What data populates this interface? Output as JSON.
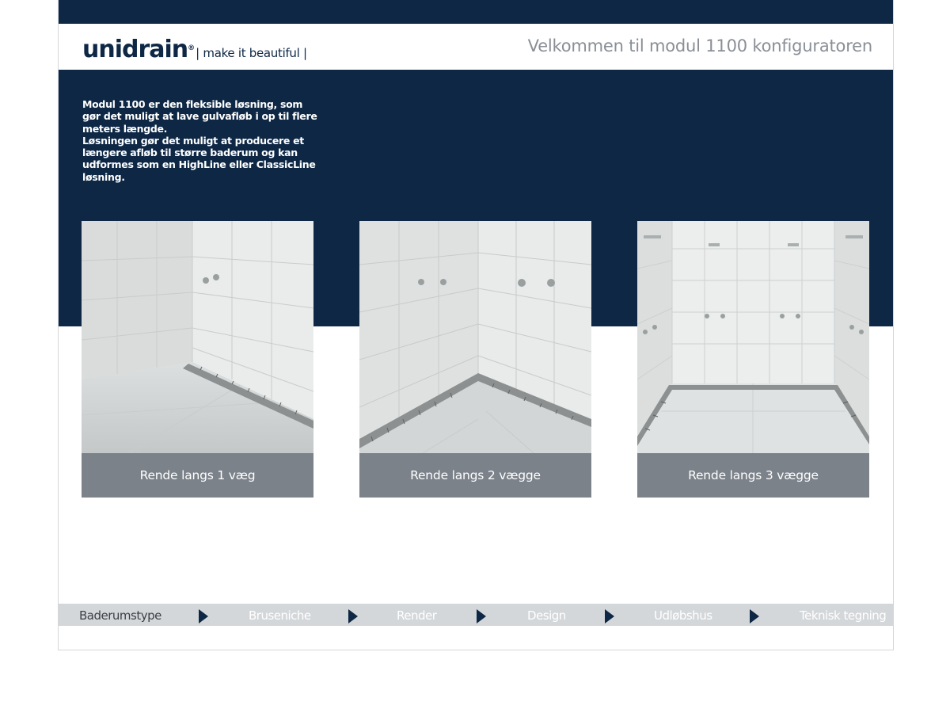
{
  "header": {
    "logo_text": "unidrain",
    "logo_reg": "®",
    "logo_tagline": "| make it beautiful |",
    "welcome": "Velkommen til modul 1100 konfiguratoren"
  },
  "intro": {
    "paragraph1": "Modul 1100 er den fleksible løsning, som gør det muligt at lave gulvafløb i op til flere meters længde.",
    "paragraph2": "Løsningen gør det muligt at producere et længere afløb til større baderum og kan udformes som en HighLine eller ClassicLine løsning."
  },
  "cards": [
    {
      "label": "Rende langs 1 væg"
    },
    {
      "label": "Rende langs 2 vægge"
    },
    {
      "label": "Rende langs 3 vægge"
    }
  ],
  "steps": [
    {
      "label": "Baderumstype",
      "active": true
    },
    {
      "label": "Bruseniche",
      "active": false
    },
    {
      "label": "Render",
      "active": false
    },
    {
      "label": "Design",
      "active": false
    },
    {
      "label": "Udløbshus",
      "active": false
    },
    {
      "label": "Teknisk tegning",
      "active": false
    }
  ],
  "colors": {
    "navy": "#0d2745",
    "card_label_bg": "#7b828a",
    "steps_bg": "#d4d7da",
    "step_active_text": "#3d4147",
    "step_inactive_text": "#ffffff",
    "welcome_text": "#8a8f96"
  },
  "icons": {
    "step_separator": "triangle-right-icon"
  }
}
